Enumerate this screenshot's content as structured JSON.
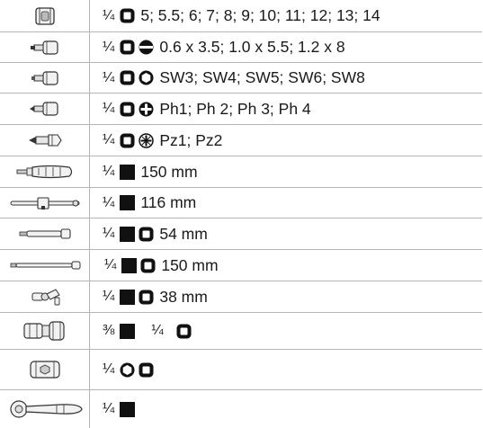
{
  "table": {
    "rows": [
      {
        "tool_icon": "short-socket-icon",
        "drive": "¼",
        "text": "5; 5.5; 6; 7; 8; 9; 10; 11; 12; 13; 14"
      },
      {
        "tool_icon": "slotted-bit-socket-icon",
        "drive": "¼",
        "text": "0.6 x 3.5; 1.0 x 5.5; 1.2 x 8"
      },
      {
        "tool_icon": "hex-bit-socket-icon",
        "drive": "¼",
        "text": "SW3; SW4; SW5; SW6; SW8"
      },
      {
        "tool_icon": "phillips-bit-socket-icon",
        "drive": "¼",
        "text": "Ph1; Ph 2; Ph 3; Ph 4"
      },
      {
        "tool_icon": "pozidriv-bit-icon",
        "drive": "¼",
        "text": "Pz1; Pz2"
      },
      {
        "tool_icon": "spinner-handle-icon",
        "drive": "¼",
        "text": "150 mm"
      },
      {
        "tool_icon": "sliding-t-bar-icon",
        "drive": "¼",
        "text": "116 mm"
      },
      {
        "tool_icon": "short-extension-bar-icon",
        "drive": "¼",
        "text": "54 mm"
      },
      {
        "tool_icon": "long-extension-bar-icon",
        "drive": "¼",
        "text": "150 mm"
      },
      {
        "tool_icon": "universal-joint-icon",
        "drive": "¼",
        "text": "38 mm"
      },
      {
        "tool_icon": "adaptor-icon",
        "drive": "⅜",
        "drive2": "¼"
      },
      {
        "tool_icon": "bit-adaptor-icon",
        "drive": "¼"
      },
      {
        "tool_icon": "ratchet-icon",
        "drive": "¼"
      }
    ]
  },
  "colors": {
    "border": "#b5b5b5",
    "symbol": "#111111",
    "text": "#1a1a1a"
  }
}
